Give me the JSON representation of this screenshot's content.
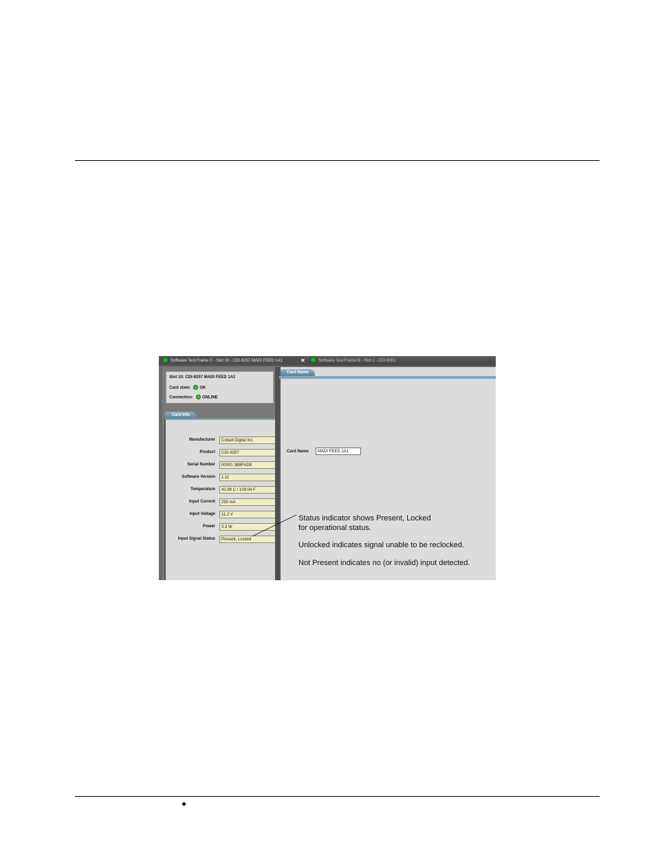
{
  "screenshot": {
    "tabs": [
      {
        "label": "Software Test Frame C - Slot 10 - CDI-9257 MADI FEED 1A1"
      },
      {
        "label": "Software Test Frame B - Slot 1 - CDI-9001"
      }
    ],
    "tab_close_glyph": "✕",
    "status_box": {
      "slot_title": "Slot 10: CDI-9257 MADI FEED 1A1",
      "card_state_label": "Card state:",
      "card_state_value": "OK",
      "connection_label": "Connection:",
      "connection_value": "ONLINE"
    },
    "card_info": {
      "tab_label": "Card Info",
      "fields": [
        {
          "label": "Manufacturer",
          "value": "Cobalt Digital Inc."
        },
        {
          "label": "Product",
          "value": "CDI-9257"
        },
        {
          "label": "Serial Number",
          "value": "00001 3B8FAD8"
        },
        {
          "label": "Software Version",
          "value": "1.11"
        },
        {
          "label": "Temperature",
          "value": "42.88 C / 109.04 F"
        },
        {
          "label": "Input Current",
          "value": "293 mA"
        },
        {
          "label": "Input Voltage",
          "value": "11.2 V"
        },
        {
          "label": "Power",
          "value": "3.3 W"
        },
        {
          "label": "Input Signal Status",
          "value": "Present, Locked"
        }
      ]
    },
    "card_name": {
      "tab_label": "Card Name",
      "field_label": "Card Name",
      "field_value": "MADI FEED 1A1"
    },
    "callouts": {
      "line1": "Status indicator shows Present, Locked",
      "line2": "for operational status.",
      "line3": "Unlocked indicates signal unable to be reclocked.",
      "line4": "Not Present indicates no (or invalid) input detected."
    },
    "colors": {
      "status_green": "#1fae2c",
      "value_field_bg": "#efecc8",
      "tab_blue": "#7fa6c0"
    }
  }
}
